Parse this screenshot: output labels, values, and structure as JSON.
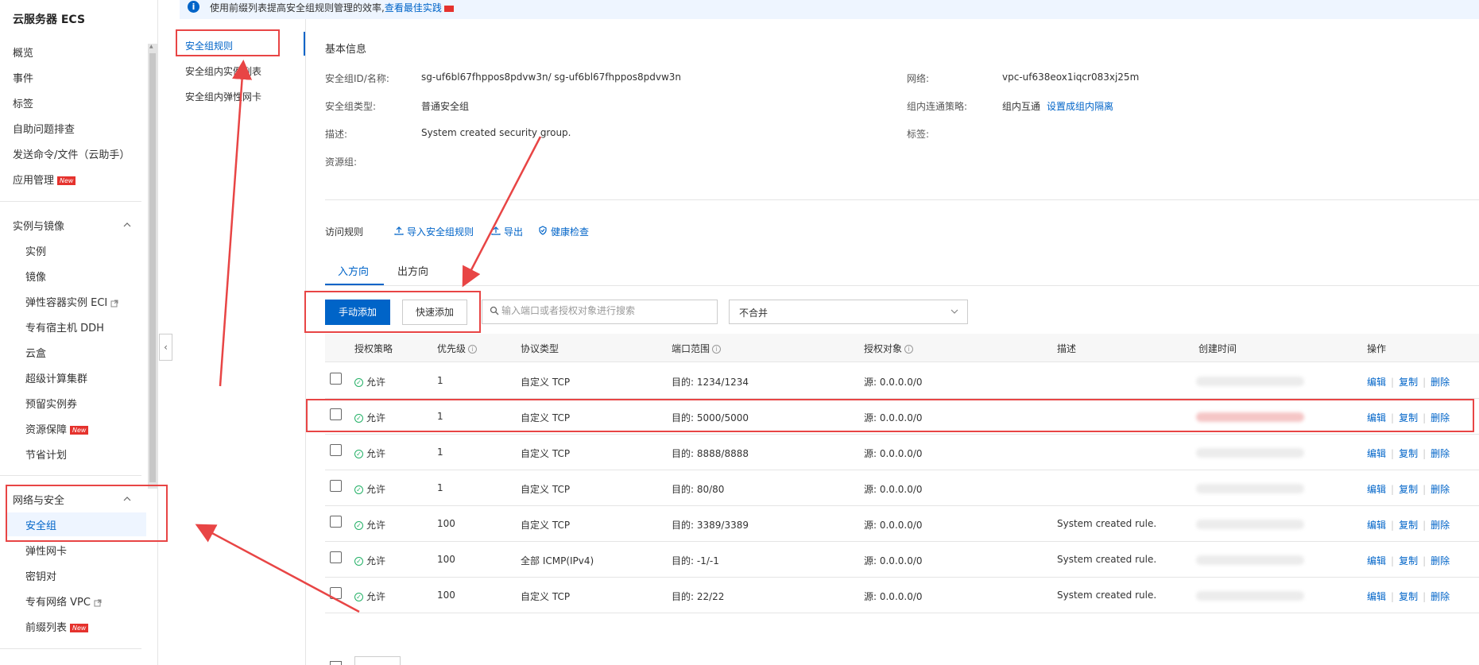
{
  "app_title": "云服务器 ECS",
  "sidebar": {
    "top_items": [
      {
        "label": "概览"
      },
      {
        "label": "事件"
      },
      {
        "label": "标签"
      },
      {
        "label": "自助问题排查"
      },
      {
        "label": "发送命令/文件（云助手）"
      },
      {
        "label": "应用管理",
        "badge": "New"
      }
    ],
    "groups": [
      {
        "label": "实例与镜像",
        "items": [
          {
            "label": "实例"
          },
          {
            "label": "镜像"
          },
          {
            "label": "弹性容器实例 ECI",
            "external": true
          },
          {
            "label": "专有宿主机 DDH"
          },
          {
            "label": "云盒"
          },
          {
            "label": "超级计算集群"
          },
          {
            "label": "预留实例券"
          },
          {
            "label": "资源保障",
            "badge": "New"
          },
          {
            "label": "节省计划"
          }
        ]
      },
      {
        "label": "网络与安全",
        "items": [
          {
            "label": "安全组",
            "active": true
          },
          {
            "label": "弹性网卡"
          },
          {
            "label": "密钥对"
          },
          {
            "label": "专有网络 VPC",
            "external": true
          },
          {
            "label": "前缀列表",
            "badge": "New"
          }
        ]
      }
    ]
  },
  "subnav": {
    "items": [
      "安全组规则",
      "安全组内实例列表",
      "安全组内弹性网卡"
    ]
  },
  "notice": {
    "text": "使用前缀列表提高安全组规则管理的效率,",
    "link": "查看最佳实践"
  },
  "basic_info": {
    "title": "基本信息",
    "rows": [
      {
        "label": "安全组ID/名称:",
        "value": "sg-uf6bl67fhppos8pdvw3n/ sg-uf6bl67fhppos8pdvw3n"
      },
      {
        "label": "安全组类型:",
        "value": "普通安全组"
      },
      {
        "label": "描述:",
        "value": "System created security group."
      },
      {
        "label": "资源组:",
        "value": ""
      }
    ],
    "right_rows": [
      {
        "label": "网络:",
        "value": "vpc-uf638eox1iqcr083xj25m"
      },
      {
        "label": "组内连通策略:",
        "value": "组内互通",
        "link": "设置成组内隔离"
      },
      {
        "label": "标签:",
        "value": ""
      }
    ]
  },
  "access_rules": {
    "title": "访问规则",
    "links": [
      "导入安全组规则",
      "导出",
      "健康检查"
    ],
    "tabs": [
      "入方向",
      "出方向"
    ],
    "buttons": {
      "manual_add": "手动添加",
      "quick_add": "快速添加"
    },
    "search_placeholder": "输入端口或者授权对象进行搜索",
    "merge_select": "不合并"
  },
  "table": {
    "columns": [
      "授权策略",
      "优先级",
      "协议类型",
      "端口范围",
      "授权对象",
      "描述",
      "创建时间",
      "操作"
    ],
    "rows": [
      {
        "policy": "允许",
        "priority": "1",
        "protocol": "自定义 TCP",
        "port": "目的: 1234/1234",
        "source": "源: 0.0.0.0/0",
        "desc": ""
      },
      {
        "policy": "允许",
        "priority": "1",
        "protocol": "自定义 TCP",
        "port": "目的: 5000/5000",
        "source": "源: 0.0.0.0/0",
        "desc": ""
      },
      {
        "policy": "允许",
        "priority": "1",
        "protocol": "自定义 TCP",
        "port": "目的: 8888/8888",
        "source": "源: 0.0.0.0/0",
        "desc": ""
      },
      {
        "policy": "允许",
        "priority": "1",
        "protocol": "自定义 TCP",
        "port": "目的: 80/80",
        "source": "源: 0.0.0.0/0",
        "desc": ""
      },
      {
        "policy": "允许",
        "priority": "100",
        "protocol": "自定义 TCP",
        "port": "目的: 3389/3389",
        "source": "源: 0.0.0.0/0",
        "desc": "System created rule."
      },
      {
        "policy": "允许",
        "priority": "100",
        "protocol": "全部 ICMP(IPv4)",
        "port": "目的: -1/-1",
        "source": "源: 0.0.0.0/0",
        "desc": "System created rule."
      },
      {
        "policy": "允许",
        "priority": "100",
        "protocol": "自定义 TCP",
        "port": "目的: 22/22",
        "source": "源: 0.0.0.0/0",
        "desc": "System created rule."
      }
    ],
    "ops": [
      "编辑",
      "复制",
      "删除"
    ]
  },
  "colors": {
    "accent": "#0064c8",
    "annotation": "#e84545",
    "new_badge": "#e5322d",
    "allow": "#23b066"
  }
}
